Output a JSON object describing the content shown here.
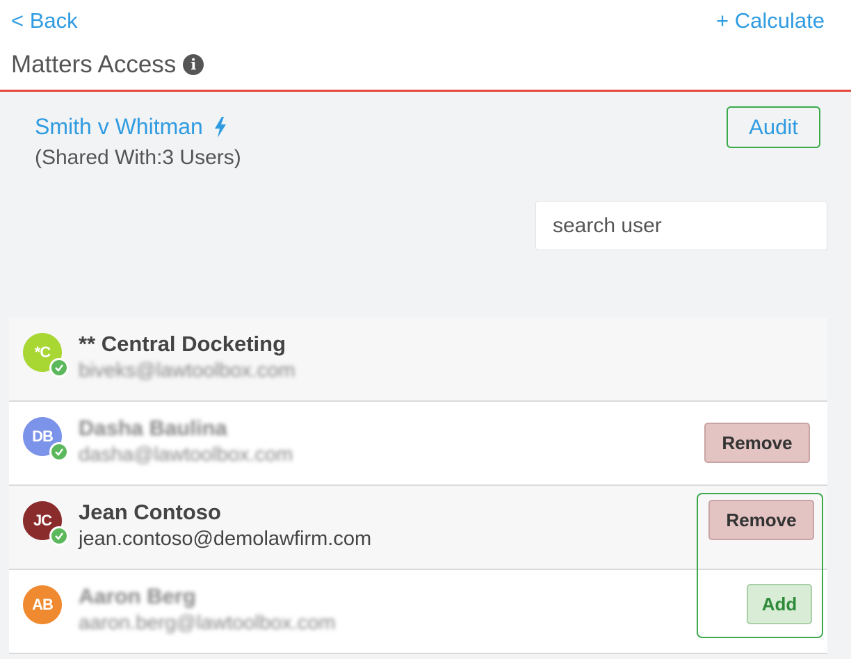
{
  "header": {
    "back_label": "< Back",
    "calculate_label": "+ Calculate",
    "title": "Matters Access"
  },
  "matter": {
    "name": "Smith v Whitman",
    "shared_with": "(Shared With:3 Users)",
    "audit_label": "Audit"
  },
  "search": {
    "placeholder": "search user"
  },
  "users": [
    {
      "initials": "*C",
      "name": "** Central Docketing",
      "email": "biveks@lawtoolbox.com",
      "avatar_color": "#a8d633",
      "verified": true,
      "action": ""
    },
    {
      "initials": "DB",
      "name": "Dasha Baulina",
      "email": "dasha@lawtoolbox.com",
      "avatar_color": "#7b93e8",
      "verified": true,
      "action": "Remove"
    },
    {
      "initials": "JC",
      "name": "Jean Contoso",
      "email": "jean.contoso@demolawfirm.com",
      "avatar_color": "#8b2c2c",
      "verified": true,
      "action": "Remove"
    },
    {
      "initials": "AB",
      "name": "Aaron Berg",
      "email": "aaron.berg@lawtoolbox.com",
      "avatar_color": "#f08a30",
      "verified": false,
      "action": "Add"
    }
  ],
  "colors": {
    "link": "#2f9be0",
    "header_border": "#e5473a",
    "highlight": "#3aaa4a",
    "remove_bg": "#e4c3c3",
    "add_bg": "#d8ecd6"
  }
}
